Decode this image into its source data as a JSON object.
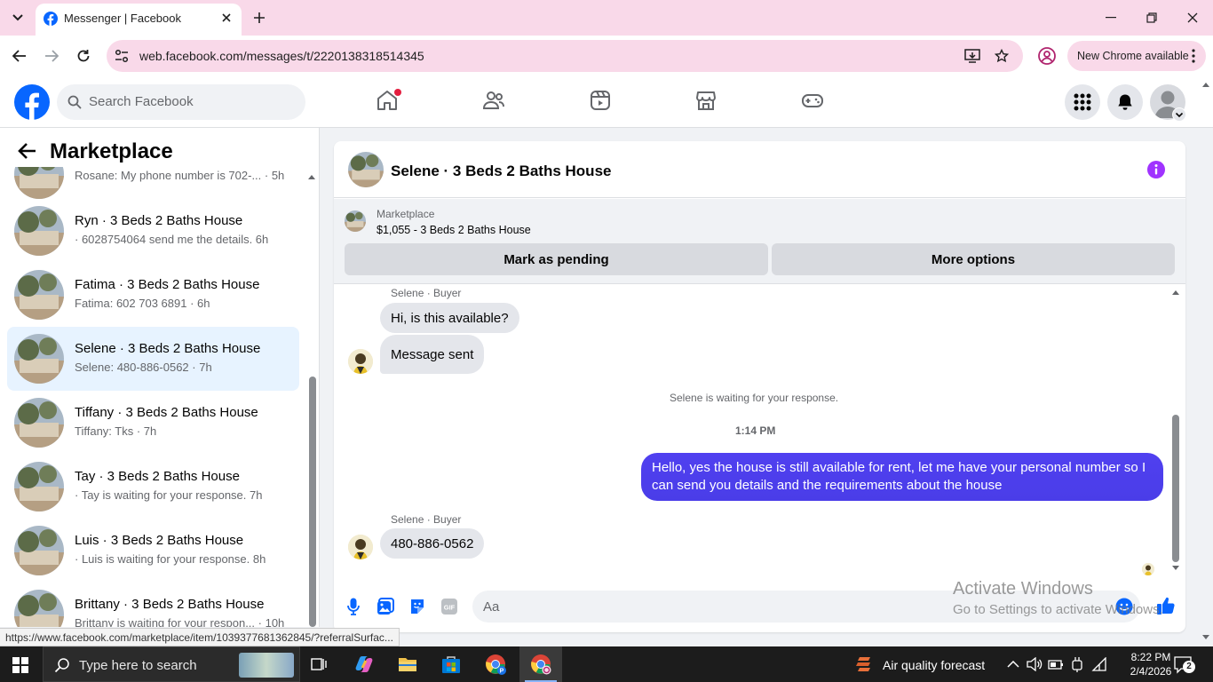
{
  "browser": {
    "tab_title": "Messenger | Facebook",
    "url": "web.facebook.com/messages/t/2220138318514345",
    "new_chrome_label": "New Chrome available",
    "status_url": "https://www.facebook.com/marketplace/item/1039377681362845/?referralSurfac..."
  },
  "fb": {
    "search_placeholder": "Search Facebook"
  },
  "marketplace": {
    "title": "Marketplace",
    "conversations": [
      {
        "name": "",
        "snippet": "Rosane: My phone number is 702-... · 5h"
      },
      {
        "name": "Ryn · 3 Beds 2 Baths House",
        "snippet": "· 6028754064 send me the details. 6h"
      },
      {
        "name": "Fatima · 3 Beds 2 Baths House",
        "snippet": "Fatima: 602 703 6891 · 6h"
      },
      {
        "name": "Selene · 3 Beds 2 Baths House",
        "snippet": "Selene: 480-886-0562 · 7h"
      },
      {
        "name": "Tiffany · 3 Beds 2 Baths House",
        "snippet": "Tiffany: Tks · 7h"
      },
      {
        "name": "Tay · 3 Beds 2 Baths House",
        "snippet": "· Tay is waiting for your response. 7h"
      },
      {
        "name": "Luis · 3 Beds 2 Baths House",
        "snippet": "· Luis is waiting for your response. 8h"
      },
      {
        "name": "Brittany · 3 Beds 2 Baths House",
        "snippet": "Brittany is waiting for your respon... · 10h"
      }
    ]
  },
  "chat": {
    "title": "Selene · 3 Beds 2 Baths House",
    "listing_category": "Marketplace",
    "listing_price_title": "$1,055 - 3 Beds 2 Baths House",
    "mark_pending_label": "Mark as pending",
    "more_options_label": "More options",
    "sender_label_1": "Selene · Buyer",
    "msg_1": "Hi, is this available?",
    "msg_2": "Message sent",
    "waiting_text": "Selene is waiting for your response.",
    "time_text": "1:14 PM",
    "msg_out_1": "Hello, yes the house is still available for rent, let me have your personal number so I can send you details and the requirements about the house",
    "sender_label_2": "Selene · Buyer",
    "msg_3": "480-886-0562",
    "composer_placeholder": "Aa"
  },
  "watermark": {
    "line1": "Activate Windows",
    "line2": "Go to Settings to activate Windows."
  },
  "taskbar": {
    "search_placeholder": "Type here to search",
    "weather_text": "Air quality forecast",
    "time": "8:22 PM",
    "date": "2/4/2026",
    "notif_count": "2"
  },
  "colors": {
    "accent_blue": "#0866ff",
    "outgoing_bubble": "#4a3de8",
    "active_conv_bg": "#e7f3ff",
    "info_icon": "#a033ff"
  },
  "icons": [
    "search-icon",
    "home-icon",
    "friends-icon",
    "video-icon",
    "marketplace-icon",
    "gaming-icon",
    "menu-grid-icon",
    "bell-icon",
    "info-icon",
    "mic-icon",
    "image-icon",
    "sticker-icon",
    "gif-icon",
    "emoji-icon",
    "like-icon"
  ]
}
